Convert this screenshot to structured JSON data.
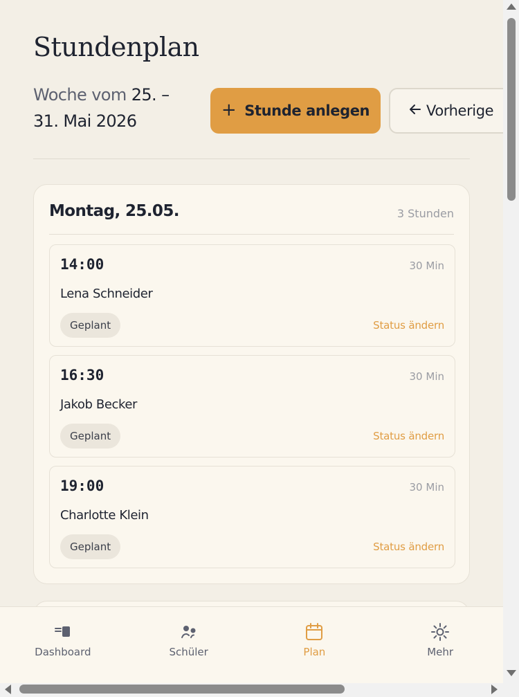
{
  "header": {
    "title": "Stundenplan",
    "week_prefix": "Woche vom",
    "week_start": "25. –",
    "week_end": "31. Mai 2026"
  },
  "actions": {
    "add_label": "Stunde anlegen",
    "add_icon": "plus-icon",
    "prev_label": "Vorherige",
    "prev_icon": "arrow-left-icon"
  },
  "day": {
    "title": "Montag, 25.05.",
    "count": "3 Stunden",
    "lessons": [
      {
        "time": "14:00",
        "duration": "30 Min",
        "student": "Lena Schneider",
        "status": "Geplant",
        "action": "Status ändern"
      },
      {
        "time": "16:30",
        "duration": "30 Min",
        "student": "Jakob Becker",
        "status": "Geplant",
        "action": "Status ändern"
      },
      {
        "time": "19:00",
        "duration": "30 Min",
        "student": "Charlotte Klein",
        "status": "Geplant",
        "action": "Status ändern"
      }
    ]
  },
  "nav": {
    "items": [
      {
        "label": "Dashboard",
        "icon": "dashboard-icon",
        "active": false
      },
      {
        "label": "Schüler",
        "icon": "students-icon",
        "active": false
      },
      {
        "label": "Plan",
        "icon": "calendar-icon",
        "active": true
      },
      {
        "label": "Mehr",
        "icon": "sun-settings-icon",
        "active": false
      }
    ]
  },
  "colors": {
    "accent": "#e09d44",
    "background": "#f3efe6",
    "card": "#fbf7ee",
    "text": "#1e2330",
    "muted": "#9a9ca3"
  }
}
